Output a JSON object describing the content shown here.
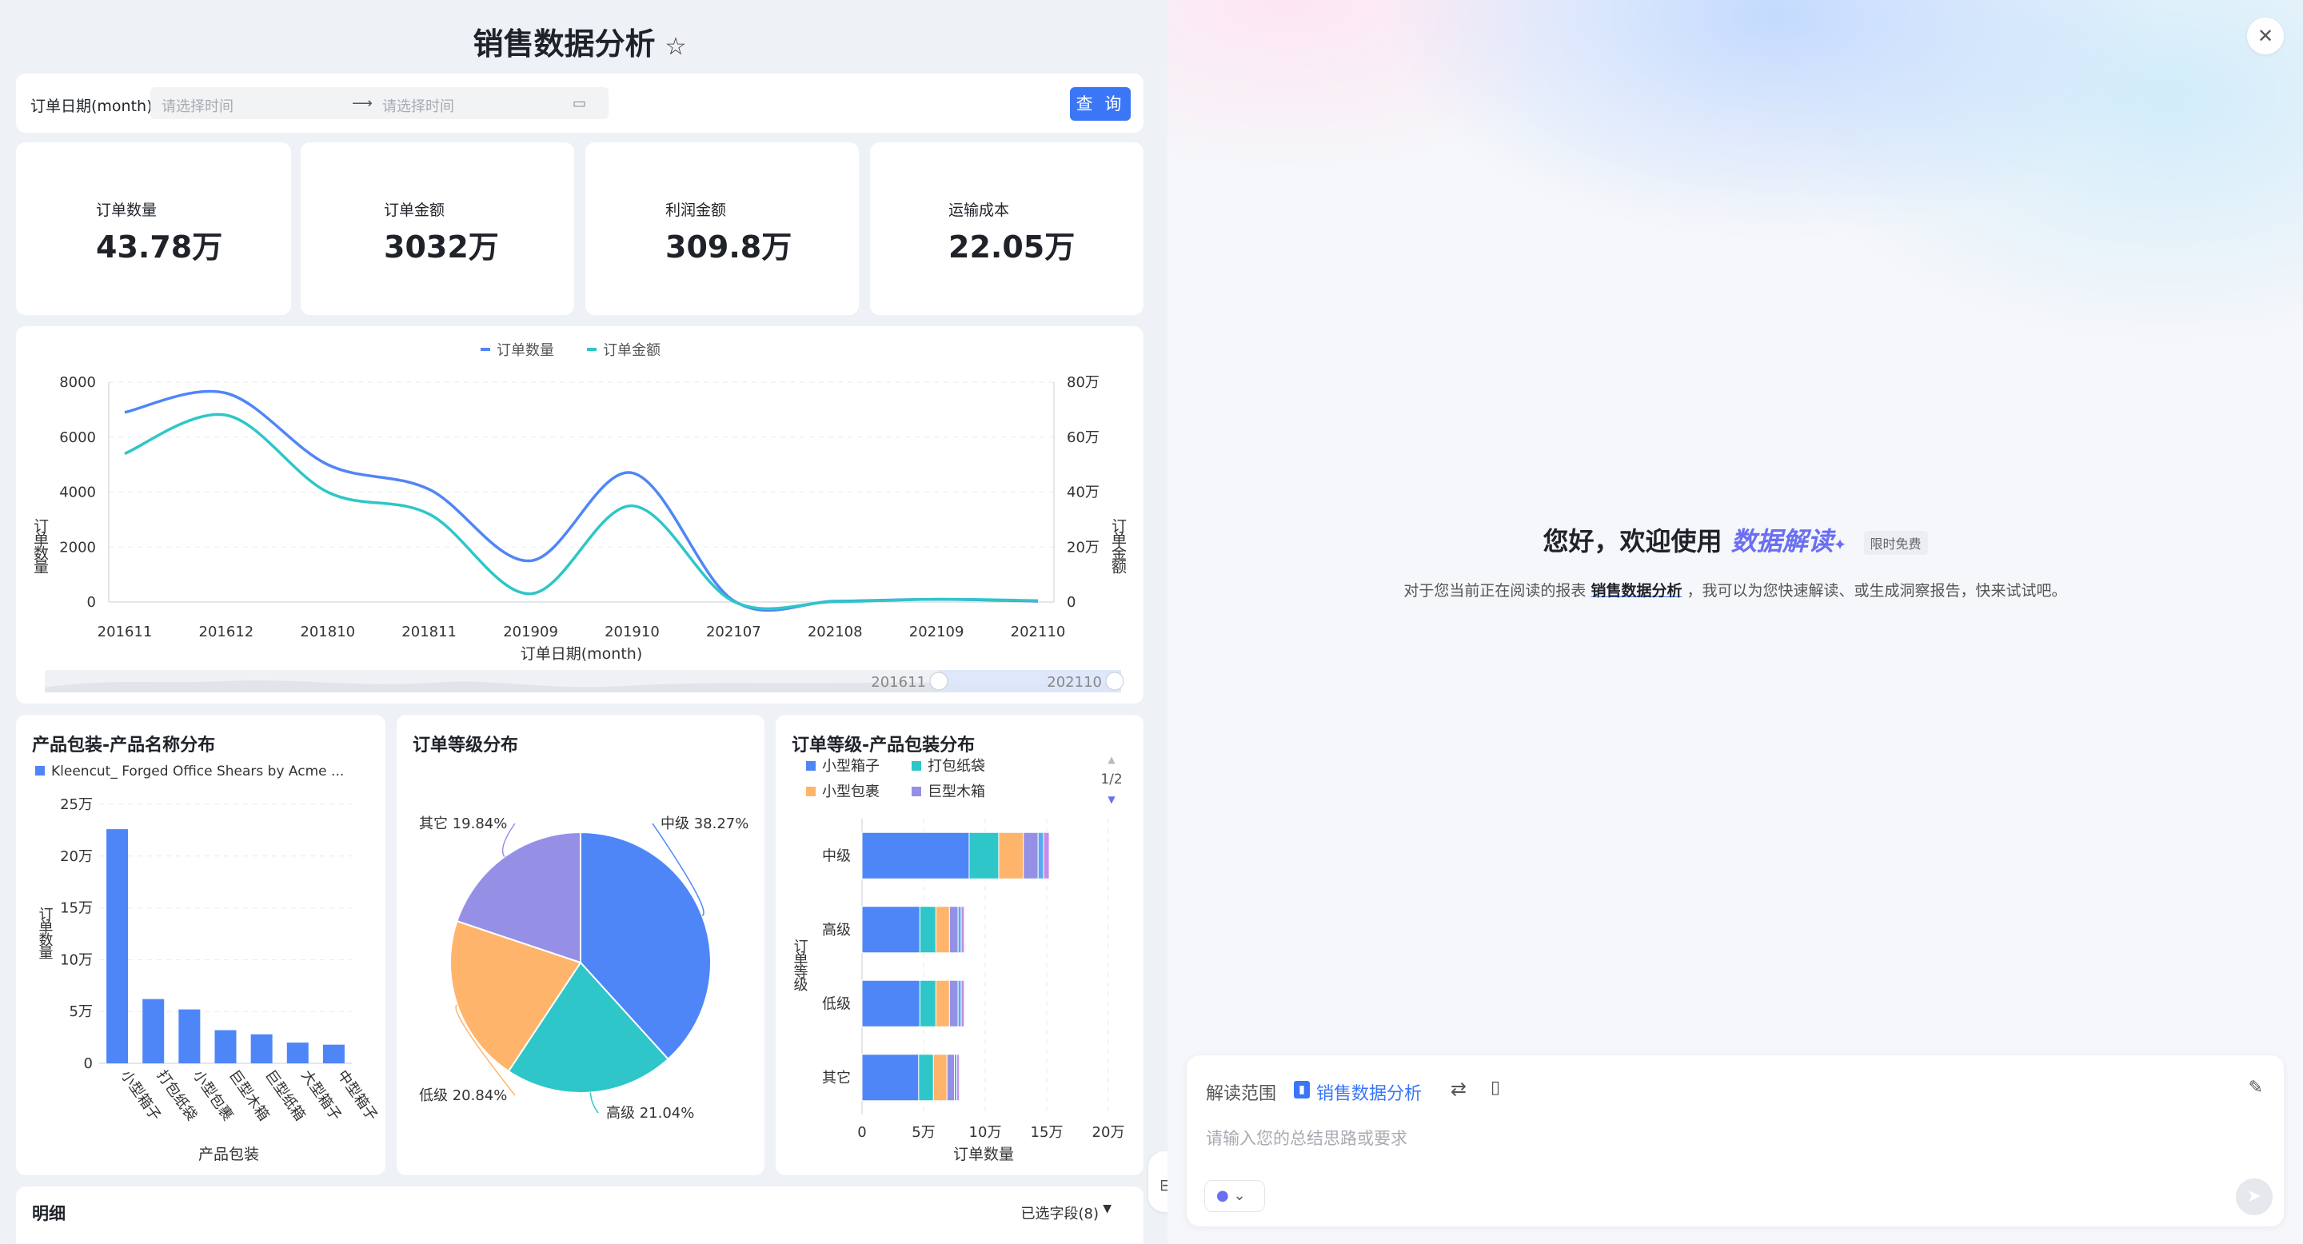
{
  "page": {
    "title": "销售数据分析",
    "star_icon": "star-outline-icon"
  },
  "filter": {
    "label": "订单日期(month)",
    "start_placeholder": "请选择时间",
    "end_placeholder": "请选择时间",
    "query_button": "查 询"
  },
  "kpis": [
    {
      "label": "订单数量",
      "value": "43.78万"
    },
    {
      "label": "订单金额",
      "value": "3032万"
    },
    {
      "label": "利润金额",
      "value": "309.8万"
    },
    {
      "label": "运输成本",
      "value": "22.05万"
    }
  ],
  "line_chart": {
    "legend": [
      "订单数量",
      "订单金额"
    ],
    "xlabel": "订单日期(month)",
    "ylabel_left": "订单数量",
    "ylabel_right": "订单金额",
    "yticks_left": [
      "8000",
      "6000",
      "4000",
      "2000",
      "0"
    ],
    "yticks_right": [
      "80万",
      "60万",
      "40万",
      "20万",
      "0"
    ],
    "xticks": [
      "201611",
      "201612",
      "201810",
      "201811",
      "201909",
      "201910",
      "202107",
      "202108",
      "202109",
      "202110"
    ],
    "slider_start": "201611",
    "slider_end": "202110"
  },
  "bar_panel": {
    "title": "产品包装-产品名称分布",
    "legend": "Kleencut_ Forged Office Shears by Acme ...",
    "yticks": [
      "25万",
      "20万",
      "15万",
      "10万",
      "5万",
      "0"
    ],
    "ylabel": "订单数量",
    "xlabel": "产品包装",
    "categories": [
      "小型箱子",
      "打包纸袋",
      "小型包裹",
      "巨型木箱",
      "巨型纸箱",
      "大型箱子",
      "中型箱子"
    ]
  },
  "pie_panel": {
    "title": "订单等级分布",
    "labels": [
      "中级 38.27%",
      "高级 21.04%",
      "低级 20.84%",
      "其它 19.84%"
    ]
  },
  "stack_panel": {
    "title": "订单等级-产品包装分布",
    "legend": [
      "小型箱子",
      "打包纸袋",
      "小型包裹",
      "巨型木箱"
    ],
    "pager": "1/2",
    "categories": [
      "中级",
      "高级",
      "低级",
      "其它"
    ],
    "xticks": [
      "0",
      "5万",
      "10万",
      "15万",
      "20万"
    ],
    "xlabel": "订单数量",
    "ylabel": "订单等级"
  },
  "detail": {
    "title": "明细",
    "fields": "已选字段(8)"
  },
  "assistant": {
    "greeting": "您好，欢迎使用",
    "brand": "数据解读",
    "tag": "限时免费",
    "desc_pre": "对于您当前正在阅读的报表",
    "desc_report": "销售数据分析",
    "desc_post": "，我可以为您快速解读、或生成洞察报告，快来试试吧。",
    "scope_label": "解读范围",
    "scope_report": "销售数据分析",
    "input_placeholder": "请输入您的总结思路或要求"
  },
  "colors": {
    "accent": "#3b76f6",
    "series_blue": "#4f86f7",
    "series_teal": "#2ec6c8",
    "pie_orange": "#ffb46b",
    "pie_purple": "#9590e6"
  },
  "chart_data": [
    {
      "type": "line",
      "x": [
        "201611",
        "201612",
        "201810",
        "201811",
        "201909",
        "201910",
        "202107",
        "202108",
        "202109",
        "202110"
      ],
      "series": [
        {
          "name": "订单数量",
          "axis": "left",
          "values": [
            6900,
            7600,
            5000,
            4100,
            1500,
            4700,
            50,
            30,
            100,
            30
          ]
        },
        {
          "name": "订单金额",
          "axis": "right",
          "values": [
            540000,
            680000,
            400000,
            320000,
            30000,
            350000,
            2000,
            1000,
            10000,
            5000
          ]
        }
      ],
      "ylim_left": [
        0,
        8000
      ],
      "ylim_right": [
        0,
        800000
      ],
      "xlabel": "订单日期(month)",
      "ylabel": "订单数量",
      "y2label": "订单金额",
      "legend": "top-center",
      "grid": true
    },
    {
      "type": "bar",
      "categories": [
        "小型箱子",
        "打包纸袋",
        "小型包裹",
        "巨型木箱",
        "巨型纸箱",
        "大型箱子",
        "中型箱子"
      ],
      "values": [
        226000,
        62000,
        52000,
        32000,
        28000,
        20000,
        18000
      ],
      "ylim": [
        0,
        250000
      ],
      "xlabel": "产品包装",
      "ylabel": "订单数量",
      "series": [
        {
          "name": "Kleencut_ Forged Office Shears by Acme ...",
          "values": [
            226000,
            62000,
            52000,
            32000,
            28000,
            20000,
            18000
          ]
        }
      ]
    },
    {
      "type": "pie",
      "categories": [
        "中级",
        "高级",
        "低级",
        "其它"
      ],
      "values": [
        38.27,
        21.04,
        20.84,
        19.84
      ]
    },
    {
      "type": "bar",
      "orientation": "horizontal",
      "stacked": true,
      "categories": [
        "中级",
        "高级",
        "低级",
        "其它"
      ],
      "series": [
        {
          "name": "小型箱子",
          "values": [
            87000,
            47000,
            47000,
            46000
          ]
        },
        {
          "name": "打包纸袋",
          "values": [
            24000,
            13000,
            13000,
            12000
          ]
        },
        {
          "name": "小型包裹",
          "values": [
            20000,
            11000,
            11000,
            11000
          ]
        },
        {
          "name": "巨型木箱",
          "values": [
            12000,
            7000,
            7000,
            6000
          ]
        }
      ],
      "other_segments": [
        9000,
        5000,
        5000,
        4000
      ],
      "xlim": [
        0,
        200000
      ],
      "xlabel": "订单数量",
      "ylabel": "订单等级"
    }
  ]
}
